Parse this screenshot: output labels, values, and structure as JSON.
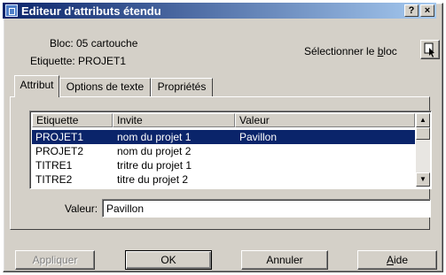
{
  "window": {
    "title": "Editeur d'attributs étendu"
  },
  "titlebar_buttons": {
    "help": "?",
    "close": "×"
  },
  "info": {
    "bloc": "Bloc: 05 cartouche",
    "etiquette": "Etiquette: PROJET1"
  },
  "select_block": {
    "label": "Sélectionner le bloc",
    "icon": "pick-block-icon"
  },
  "tabs": [
    {
      "label": "Attribut",
      "active": true
    },
    {
      "label": "Options de texte",
      "active": false
    },
    {
      "label": "Propriétés",
      "active": false
    }
  ],
  "table": {
    "columns": [
      "Etiquette",
      "Invite",
      "Valeur"
    ],
    "rows": [
      {
        "etiquette": "PROJET1",
        "invite": "nom du projet 1",
        "valeur": "Pavillon",
        "selected": true
      },
      {
        "etiquette": "PROJET2",
        "invite": "nom du projet 2",
        "valeur": "",
        "selected": false
      },
      {
        "etiquette": "TITRE1",
        "invite": "tritre du projet 1",
        "valeur": "",
        "selected": false
      },
      {
        "etiquette": "TITRE2",
        "invite": "titre du projet 2",
        "valeur": "",
        "selected": false
      }
    ]
  },
  "value_field": {
    "label": "Valeur:",
    "value": "Pavillon"
  },
  "buttons": {
    "apply": "Appliquer",
    "ok": "OK",
    "cancel": "Annuler",
    "help": "Aide"
  },
  "colors": {
    "titlebar_start": "#0a246a",
    "titlebar_end": "#a6caf0",
    "selection": "#0a246a",
    "face": "#d4d0c8"
  }
}
